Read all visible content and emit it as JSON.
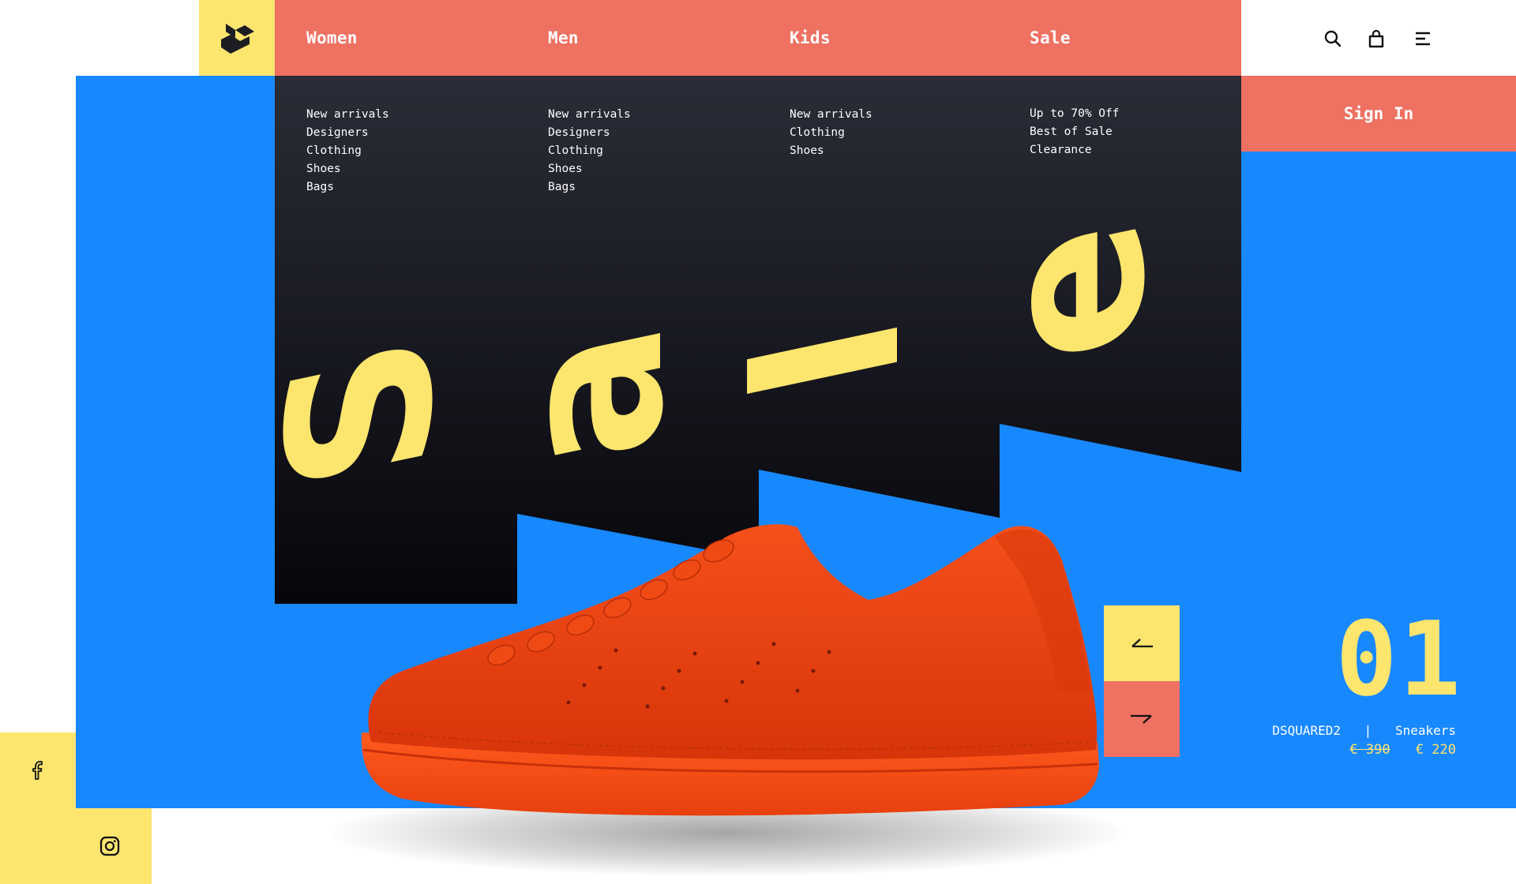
{
  "nav": {
    "items": [
      {
        "label": "Women",
        "submenu": [
          "New arrivals",
          "Designers",
          "Clothing",
          "Shoes",
          "Bags"
        ]
      },
      {
        "label": "Men",
        "submenu": [
          "New arrivals",
          "Designers",
          "Clothing",
          "Shoes",
          "Bags"
        ]
      },
      {
        "label": "Kids",
        "submenu": [
          "New arrivals",
          "Clothing",
          "Shoes"
        ]
      },
      {
        "label": "Sale",
        "submenu": [
          "Up to 70% Off",
          "Best of Sale",
          "Clearance"
        ]
      }
    ]
  },
  "header_icons": [
    "search-icon",
    "shopping-bag-icon",
    "menu-icon"
  ],
  "signin_label": "Sign In",
  "hero": {
    "letters": [
      "S",
      "a",
      "l",
      "e"
    ]
  },
  "product": {
    "slide_number": "01",
    "brand": "DSQUARED2",
    "separator": "|",
    "category": "Sneakers",
    "old_price": "€ 390",
    "new_price": "€ 220"
  },
  "social_icons": [
    "facebook-icon",
    "instagram-icon"
  ],
  "colors": {
    "yellow": "#FDE56E",
    "coral": "#EE7162",
    "blue": "#1888FF",
    "dark": "#15161C",
    "sneaker": "#F2400C"
  }
}
